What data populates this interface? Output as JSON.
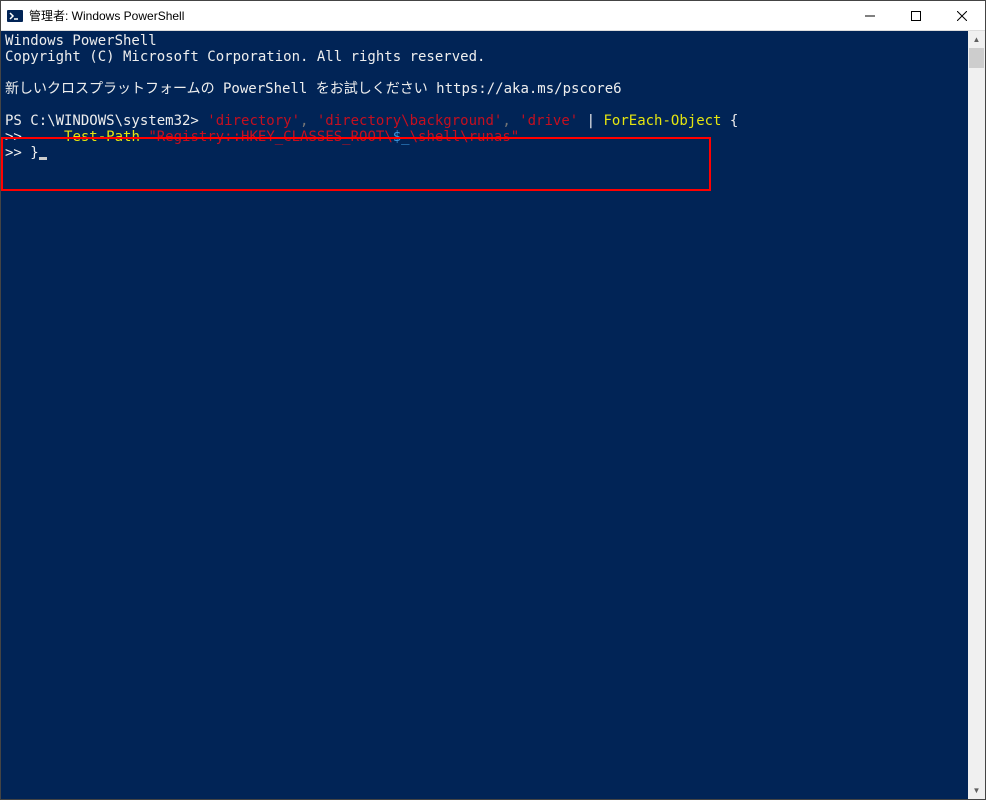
{
  "titlebar": {
    "title": "管理者: Windows PowerShell"
  },
  "terminal": {
    "line1": "Windows PowerShell",
    "line2": "Copyright (C) Microsoft Corporation. All rights reserved.",
    "line3": "新しいクロスプラットフォームの PowerShell をお試しください https://aka.ms/pscore6",
    "prompt": "PS C:\\WINDOWS\\system32> ",
    "str1": "'directory'",
    "comma1": ", ",
    "str2": "'directory\\background'",
    "comma2": ", ",
    "str3": "'drive'",
    "pipe": " | ",
    "cmd1": "ForEach-Object ",
    "brace_open": "{",
    "cont1": ">>     ",
    "cmd2": "Test-Path ",
    "regpath_prefix": "\"Registry::HKEY_CLASSES_ROOT\\",
    "regpath_var": "$_",
    "regpath_suffix": "\\shell\\runas\"",
    "cont2": ">> ",
    "brace_close": "}"
  }
}
